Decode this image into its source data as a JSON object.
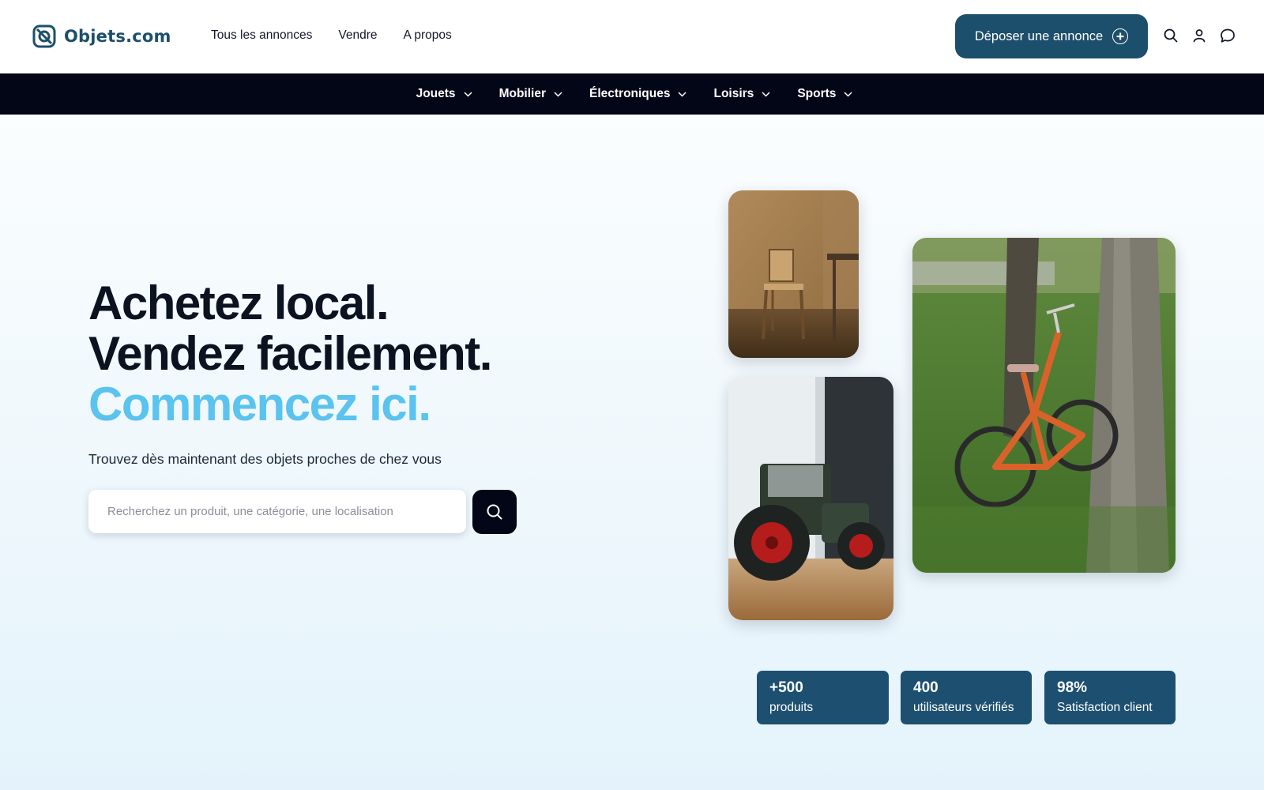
{
  "brand": {
    "name": "Objets.com",
    "color": "#1c4f6b"
  },
  "nav": {
    "links": [
      "Tous les annonces",
      "Vendre",
      "A propos"
    ]
  },
  "header": {
    "cta_label": "Déposer une annonce",
    "cta_icon": "plus-circle-icon",
    "icons": [
      "search-icon",
      "user-icon",
      "chat-bubble-icon"
    ]
  },
  "categories": [
    "Jouets",
    "Mobilier",
    "Électroniques",
    "Loisirs",
    "Sports"
  ],
  "hero": {
    "line1": "Achetez local.",
    "line2": "Vendez facilement.",
    "line3": "Commencez ici.",
    "accent_color": "#5bc3ef",
    "subtitle": "Trouvez dès maintenant des objets proches de chez vous"
  },
  "search": {
    "placeholder": "Recherchez un produit, une catégorie, une localisation",
    "value": "",
    "button_icon": "search-icon"
  },
  "photos": [
    "wooden-chair-photo",
    "toy-tractor-photo",
    "orange-bicycle-photo"
  ],
  "stats": [
    {
      "value": "+500",
      "label": "produits"
    },
    {
      "value": "400",
      "label": "utilisateurs vérifiés"
    },
    {
      "value": "98%",
      "label": "Satisfaction client"
    }
  ]
}
